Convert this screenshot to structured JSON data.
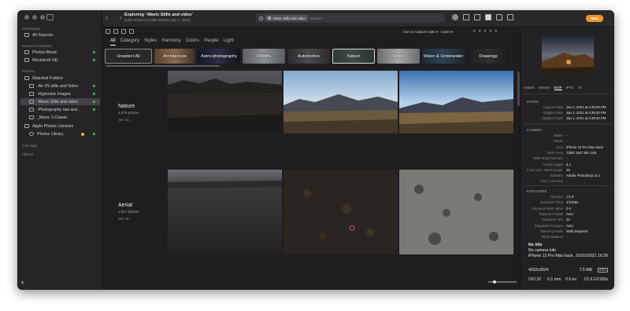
{
  "sidebar": {
    "sections": {
      "workspaces": "Workspaces",
      "sources": "Sources & Volumes",
      "sources2": "Sources",
      "your_apps": "Your Apps",
      "albums": "Albums"
    },
    "all_sources": "All Sources",
    "volumes": [
      "Photos-Music",
      "Macintosh HD"
    ],
    "folders_header": "Watched Folders",
    "folders": [
      "-Air 2S stills and Video",
      "-Hyperstar Images",
      "-Mavic Stills and video",
      "-Photography raw and...",
      "_Mavic 3 Classic"
    ],
    "libraries_header": "Apple Photos Libraries",
    "photos_library": "Photos Library",
    "add": "+"
  },
  "toolbar": {
    "title": "Exploring '-Mavic Stills and video'",
    "subtitle": "5,054 Versions | 5,054 Instants (Jan 1, 2021)",
    "search_chip": "-Mavic Stills and video",
    "search_placeholder": "Search",
    "beta": "Beta",
    "nav": "‹ ›"
  },
  "sortbar": {
    "sort": "Sort on  Capture Date ▾",
    "colors": "Colors ▾",
    "stars": "★ ★ ★ ★ ★"
  },
  "cattabs": [
    "All",
    "Category",
    "Styles",
    "Harmony",
    "Colors",
    "People",
    "Light"
  ],
  "chips": [
    {
      "label": "Unselect All",
      "state": "unsel",
      "w": 60
    },
    {
      "label": "Architecture",
      "state": "norm",
      "w": 52
    },
    {
      "label": "Astro-photography",
      "state": "norm",
      "w": 54
    },
    {
      "label": "Wildlife",
      "state": "norm",
      "w": 54
    },
    {
      "label": "Automotive",
      "state": "norm",
      "w": 54
    },
    {
      "label": "Nature",
      "state": "sel",
      "w": 54
    },
    {
      "label": "Street",
      "state": "norm",
      "w": 54
    },
    {
      "label": "Water & Underwater",
      "state": "norm",
      "w": 54
    },
    {
      "label": "Drawings",
      "state": "norm",
      "w": 54
    }
  ],
  "groups": [
    {
      "title": "Nature",
      "count": "4,475 photos",
      "see_all": "See All..."
    },
    {
      "title": "Aerial",
      "count": "2,917 photos",
      "see_all": "See All..."
    }
  ],
  "inspector": {
    "tabs": [
      "Instant",
      "Version",
      "EXIF",
      "IPTC",
      "AI"
    ],
    "dates_header": "DATES",
    "dates": [
      {
        "k": "Capture Date",
        "v": "Jan 1, 2021 at 4:39:30 PM"
      },
      {
        "k": "Original Date",
        "v": "Jan 1, 2021 at 4:39:30 PM"
      },
      {
        "k": "Digitized Date",
        "v": "Jan 1, 2021 at 4:39:30 PM"
      }
    ],
    "camera_header": "CAMERA",
    "camera": [
      {
        "k": "Maker",
        "v": "-"
      },
      {
        "k": "Model",
        "v": "-"
      },
      {
        "k": "Lens",
        "v": "iPhone 12 Pro Max back"
      },
      {
        "k": "EXIF Lens",
        "v": "7350/ 1527 8/5 12/5"
      },
      {
        "k": "DNP Serial Number",
        "v": "-"
      },
      {
        "k": "Focal Length",
        "v": "5.1"
      },
      {
        "k": "Focal Len. 35mm Equiv.",
        "v": "26"
      },
      {
        "k": "Software",
        "v": "Adobe Photoshop 22.1"
      },
      {
        "k": "User Comment",
        "v": "-"
      }
    ],
    "exposure_header": "EXPOSURE",
    "exposure": [
      {
        "k": "Aperture",
        "v": "ƒ/1.6"
      },
      {
        "k": "Exposure Time",
        "v": "1/2165s"
      },
      {
        "k": "Exposure Bias Value",
        "v": "0.0"
      },
      {
        "k": "Exposure Mode",
        "v": "Auto"
      },
      {
        "k": "Exposure ISO",
        "v": "32"
      },
      {
        "k": "Exposure Program",
        "v": "Auto"
      },
      {
        "k": "Metering Mode",
        "v": "Multi Segment"
      },
      {
        "k": "White Balance",
        "v": "-"
      }
    ]
  },
  "info": {
    "title": "No title",
    "info": "No camera info",
    "lens": "iPhone 12 Pro Max back...",
    "date": "01/01/2021 16:39",
    "dims": "4032x3024",
    "size": "7.5 MB",
    "format": "JPEG",
    "iso": "ISO 32",
    "focal": "5.1 mm",
    "ev": "0.0 ev",
    "aperture": "ƒ/1.6",
    "shutter": "1/2165s"
  }
}
